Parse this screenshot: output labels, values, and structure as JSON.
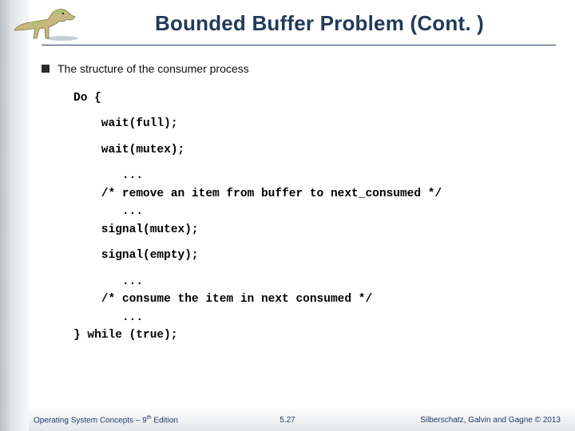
{
  "title": "Bounded Buffer Problem (Cont. )",
  "bullet": "The structure of the consumer process",
  "code": {
    "l1": "Do {",
    "l2": "    wait(full);",
    "l3": "    wait(mutex);",
    "l4": "       ...",
    "l5": "    /* remove an item from buffer to next_consumed */",
    "l6": "       ...",
    "l7": "    signal(mutex);",
    "l8": "    signal(empty);",
    "l9": "       ...",
    "l10": "    /* consume the item in next consumed */",
    "l11": "       ...",
    "l12": "} while (true);"
  },
  "footer": {
    "left_prefix": "Operating System Concepts – 9",
    "left_suffix": " Edition",
    "th": "th",
    "center": "5.27",
    "right": "Silberschatz, Galvin and Gagne © 2013"
  },
  "icons": {
    "dinosaur": "dinosaur-logo"
  }
}
